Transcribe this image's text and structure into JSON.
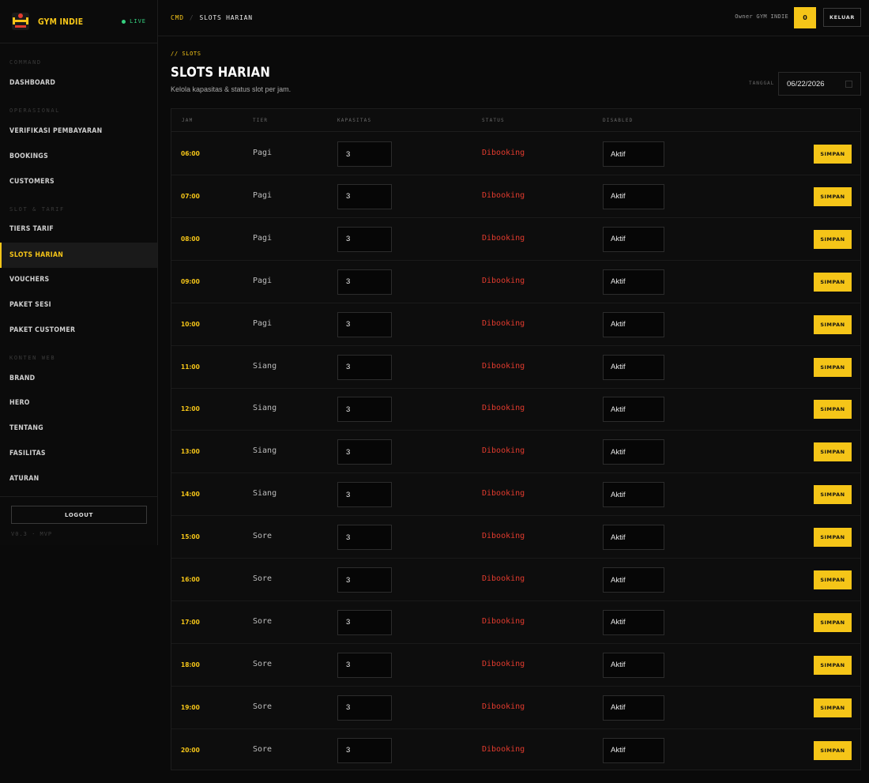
{
  "brand": {
    "name": "GYM INDIE",
    "live_label": "LIVE",
    "logo_icon": "gym-logo-icon",
    "accent": "#f5c518"
  },
  "sidebar": {
    "sections": [
      {
        "label": "COMMAND",
        "items": [
          "DASHBOARD"
        ]
      },
      {
        "label": "OPERASIONAL",
        "items": [
          "VERIFIKASI PEMBAYARAN",
          "BOOKINGS",
          "CUSTOMERS"
        ]
      },
      {
        "label": "SLOT & TARIF",
        "items": [
          "TIERS TARIF",
          "SLOTS HARIAN",
          "VOUCHERS",
          "PAKET SESI",
          "PAKET CUSTOMER"
        ]
      },
      {
        "label": "KONTEN WEB",
        "items": [
          "BRAND",
          "HERO",
          "TENTANG",
          "FASILITAS",
          "ATURAN"
        ]
      }
    ],
    "active_item": "SLOTS HARIAN",
    "logout_label": "LOGOUT",
    "version": "V0.3 · MVP"
  },
  "topbar": {
    "breadcrumb_root": "CMD",
    "breadcrumb_sep": "/",
    "breadcrumb_current": "SLOTS HARIAN",
    "owner_text": "Owner GYM INDIE",
    "badge": "0",
    "logout_label": "KELUAR"
  },
  "page": {
    "eyebrow": "// SLOTS",
    "title": "SLOTS HARIAN",
    "subtitle": "Kelola kapasitas & status slot per jam.",
    "date_label": "TANGGAL",
    "date_value": "06/22/2026"
  },
  "table": {
    "headers": [
      "JAM",
      "TIER",
      "KAPASITAS",
      "STATUS",
      "DISABLED"
    ],
    "save_label": "SIMPAN",
    "rows": [
      {
        "jam": "06:00",
        "tier": "Pagi",
        "kapasitas": "3",
        "status": "Dibooking",
        "disabled": "Aktif"
      },
      {
        "jam": "07:00",
        "tier": "Pagi",
        "kapasitas": "3",
        "status": "Dibooking",
        "disabled": "Aktif"
      },
      {
        "jam": "08:00",
        "tier": "Pagi",
        "kapasitas": "3",
        "status": "Dibooking",
        "disabled": "Aktif"
      },
      {
        "jam": "09:00",
        "tier": "Pagi",
        "kapasitas": "3",
        "status": "Dibooking",
        "disabled": "Aktif"
      },
      {
        "jam": "10:00",
        "tier": "Pagi",
        "kapasitas": "3",
        "status": "Dibooking",
        "disabled": "Aktif"
      },
      {
        "jam": "11:00",
        "tier": "Siang",
        "kapasitas": "3",
        "status": "Dibooking",
        "disabled": "Aktif"
      },
      {
        "jam": "12:00",
        "tier": "Siang",
        "kapasitas": "3",
        "status": "Dibooking",
        "disabled": "Aktif"
      },
      {
        "jam": "13:00",
        "tier": "Siang",
        "kapasitas": "3",
        "status": "Dibooking",
        "disabled": "Aktif"
      },
      {
        "jam": "14:00",
        "tier": "Siang",
        "kapasitas": "3",
        "status": "Dibooking",
        "disabled": "Aktif"
      },
      {
        "jam": "15:00",
        "tier": "Sore",
        "kapasitas": "3",
        "status": "Dibooking",
        "disabled": "Aktif"
      },
      {
        "jam": "16:00",
        "tier": "Sore",
        "kapasitas": "3",
        "status": "Dibooking",
        "disabled": "Aktif"
      },
      {
        "jam": "17:00",
        "tier": "Sore",
        "kapasitas": "3",
        "status": "Dibooking",
        "disabled": "Aktif"
      },
      {
        "jam": "18:00",
        "tier": "Sore",
        "kapasitas": "3",
        "status": "Dibooking",
        "disabled": "Aktif"
      },
      {
        "jam": "19:00",
        "tier": "Sore",
        "kapasitas": "3",
        "status": "Dibooking",
        "disabled": "Aktif"
      },
      {
        "jam": "20:00",
        "tier": "Sore",
        "kapasitas": "3",
        "status": "Dibooking",
        "disabled": "Aktif"
      }
    ]
  },
  "colors": {
    "accent": "#f5c518",
    "status_booked": "#e23b2e",
    "live": "#35d07f",
    "background": "#0a0a0a"
  }
}
